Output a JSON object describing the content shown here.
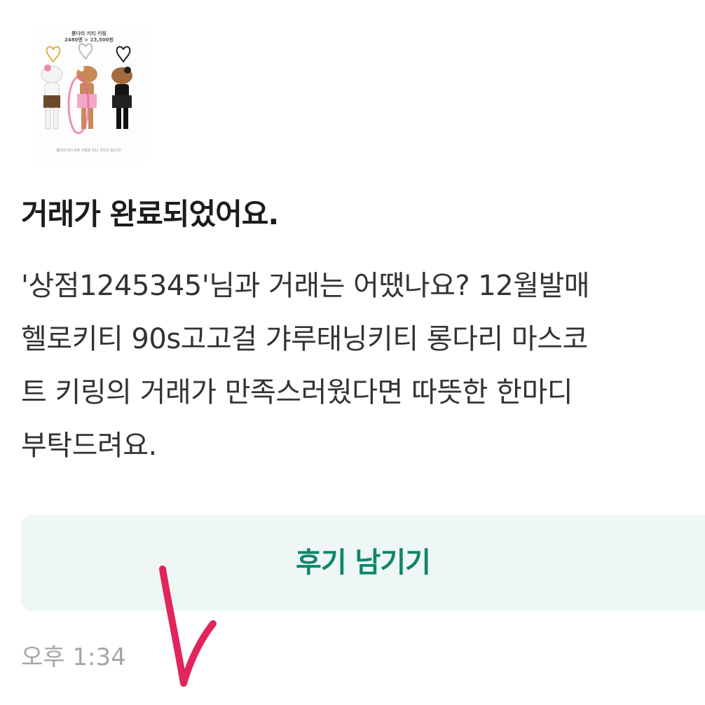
{
  "message": {
    "thumbnail": {
      "title": "롱다리 키티 키링",
      "price_line": "2480엔 > 23,500원",
      "caption": "롱다리 마스코트 키링은 미니 사이즈 입니다!"
    },
    "title": "거래가 완료되었어요.",
    "body_lines": [
      "'상점1245345'님과 거래는 어땠나요? 12월발매",
      "헬로키티 90s고고걸 갸루태닝키티 롱다리 마스코",
      "트 키링의 거래가 만족스러웠다면 따뜻한 한마디",
      "부탁드려요."
    ],
    "review_button_label": "후기 남기기",
    "time": "오후 1:34"
  },
  "colors": {
    "accent_green": "#10856c",
    "button_bg": "#eef7f5",
    "annotation_red": "#e2245c"
  }
}
